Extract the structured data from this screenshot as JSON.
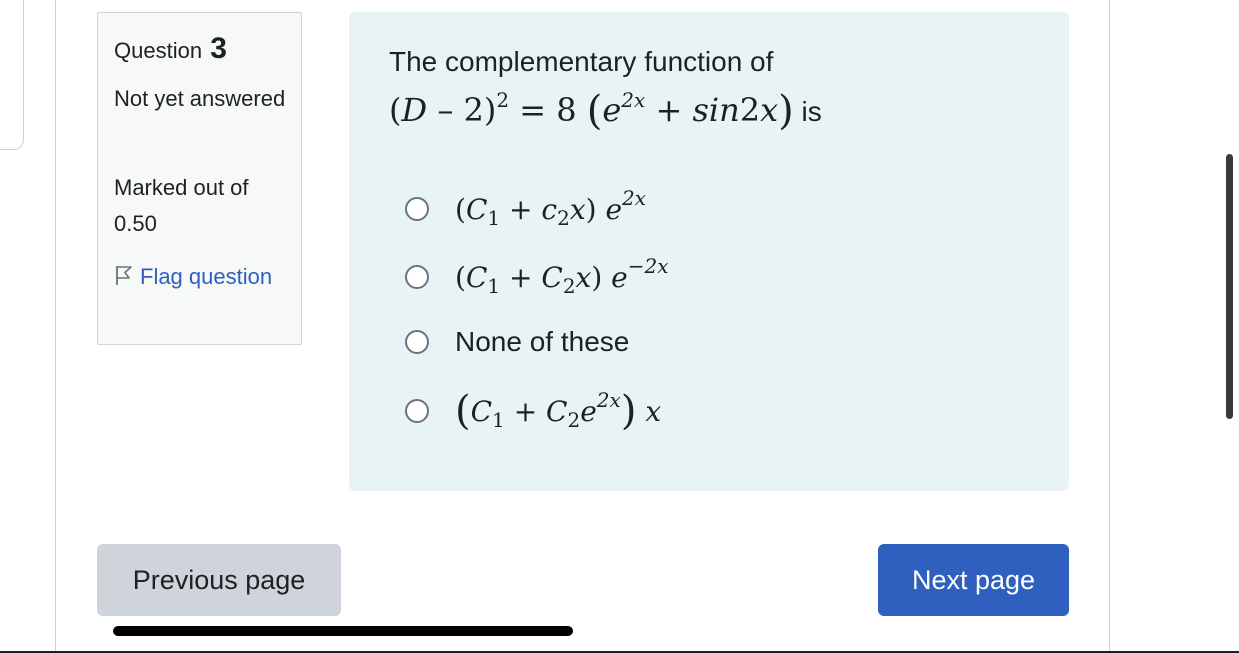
{
  "question": {
    "label": "Question",
    "number": "3",
    "state": "Not yet answered",
    "marked_out_of_label": "Marked out of",
    "marked_out_of_value": "0.50",
    "flag_label": "Flag question"
  },
  "qtext": {
    "prefix": "The complementary function of",
    "suffix": "is"
  },
  "options": [
    {
      "id": "a",
      "text": "(C1 + c2x) e^2x"
    },
    {
      "id": "b",
      "text": "(C1 + C2x) e^-2x"
    },
    {
      "id": "c",
      "text": "None of these"
    },
    {
      "id": "d",
      "text": "(C1 + C2e^2x) x"
    }
  ],
  "nav": {
    "prev_label": "Previous page",
    "next_label": "Next page"
  },
  "colors": {
    "accent": "#2f5fbf",
    "content_bg": "#e7f3f5",
    "info_bg": "#f7f8f8",
    "secondary_btn": "#ced4da"
  },
  "icons": {
    "flag": "flag-outline-icon"
  }
}
